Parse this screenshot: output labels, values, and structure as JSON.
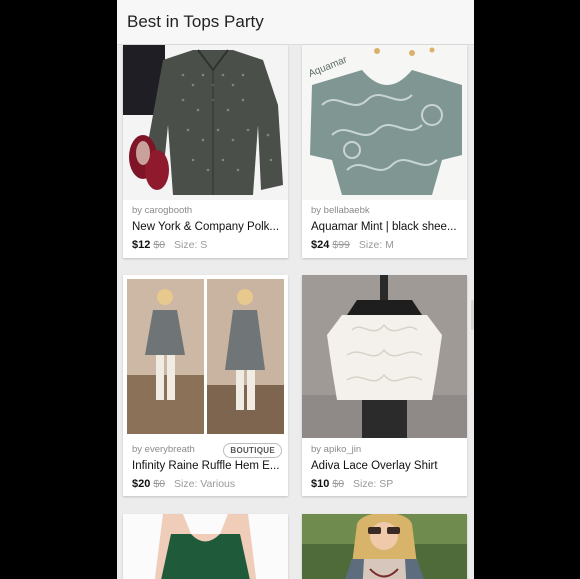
{
  "header": {
    "title": "Best in Tops Party"
  },
  "listings": [
    {
      "seller": "by carogbooth",
      "title": "New York & Company Polk...",
      "price": "$12",
      "original_price": "$0",
      "size": "Size: S",
      "image": "polka-dot-shirt-with-red-heels"
    },
    {
      "seller": "by bellabaebk",
      "title": "Aquamar Mint | black shee...",
      "price": "$24",
      "original_price": "$99",
      "size": "Size: M",
      "image": "paisley-print-top-with-earrings",
      "image_text": "Aquamar"
    },
    {
      "seller": "by everybreath",
      "title": "Infinity Raine Ruffle Hem E...",
      "price": "$20",
      "original_price": "$0",
      "size": "Size: Various",
      "badge": "BOUTIQUE",
      "image": "model-in-gray-ruffle-tunic"
    },
    {
      "seller": "by apiko_jin",
      "title": "Adiva Lace Overlay Shirt",
      "price": "$10",
      "original_price": "$0",
      "size": "Size: SP",
      "image": "white-lace-blouse-on-dress-form"
    },
    {
      "image": "green-halter-top"
    },
    {
      "image": "model-with-sunglasses-and-vest"
    }
  ],
  "colors": {
    "background": "#ececec",
    "header": "#f7f7f7",
    "card": "#ffffff",
    "muted_text": "#999999"
  }
}
